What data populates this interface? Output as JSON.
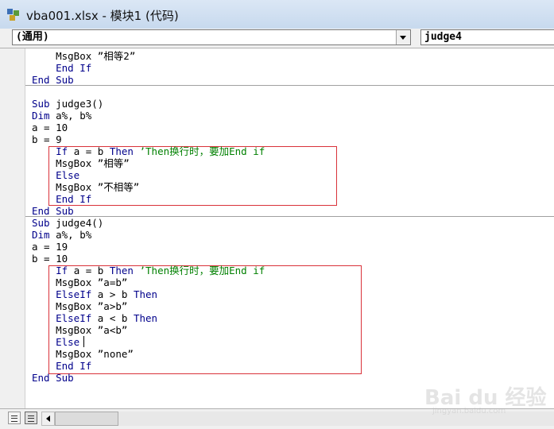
{
  "window": {
    "title": "vba001.xlsx - 模块1 (代码)"
  },
  "combos": {
    "object": "(通用)",
    "procedure": "judge4"
  },
  "code": {
    "lines": [
      [
        {
          "t": "    MsgBox ”相等2”",
          "c": ""
        }
      ],
      [
        {
          "t": "    ",
          "c": ""
        },
        {
          "t": "End If",
          "c": "kw"
        }
      ],
      [
        {
          "t": "End Sub",
          "c": "kw"
        }
      ],
      [
        {
          "t": "",
          "c": ""
        }
      ],
      [
        {
          "t": "Sub",
          "c": "kw"
        },
        {
          "t": " judge3()",
          "c": ""
        }
      ],
      [
        {
          "t": "Dim",
          "c": "kw"
        },
        {
          "t": " a%, b%",
          "c": ""
        }
      ],
      [
        {
          "t": "a = 10",
          "c": ""
        }
      ],
      [
        {
          "t": "b = 9",
          "c": ""
        }
      ],
      [
        {
          "t": "    ",
          "c": ""
        },
        {
          "t": "If",
          "c": "kw"
        },
        {
          "t": " a = b ",
          "c": ""
        },
        {
          "t": "Then",
          "c": "kw"
        },
        {
          "t": " ’Then换行时，要加End if",
          "c": "cm"
        }
      ],
      [
        {
          "t": "    MsgBox ”相等”",
          "c": ""
        }
      ],
      [
        {
          "t": "    ",
          "c": ""
        },
        {
          "t": "Else",
          "c": "kw"
        }
      ],
      [
        {
          "t": "    MsgBox ”不相等”",
          "c": ""
        }
      ],
      [
        {
          "t": "    ",
          "c": ""
        },
        {
          "t": "End If",
          "c": "kw"
        }
      ],
      [
        {
          "t": "End Sub",
          "c": "kw"
        }
      ],
      [
        {
          "t": "Sub",
          "c": "kw"
        },
        {
          "t": " judge4()",
          "c": ""
        }
      ],
      [
        {
          "t": "Dim",
          "c": "kw"
        },
        {
          "t": " a%, b%",
          "c": ""
        }
      ],
      [
        {
          "t": "a = 19",
          "c": ""
        }
      ],
      [
        {
          "t": "b = 10",
          "c": ""
        }
      ],
      [
        {
          "t": "    ",
          "c": ""
        },
        {
          "t": "If",
          "c": "kw"
        },
        {
          "t": " a = b ",
          "c": ""
        },
        {
          "t": "Then",
          "c": "kw"
        },
        {
          "t": " ’Then换行时，要加End if",
          "c": "cm"
        }
      ],
      [
        {
          "t": "    MsgBox ”a=b”",
          "c": ""
        }
      ],
      [
        {
          "t": "    ",
          "c": ""
        },
        {
          "t": "ElseIf",
          "c": "kw"
        },
        {
          "t": " a > b ",
          "c": ""
        },
        {
          "t": "Then",
          "c": "kw"
        }
      ],
      [
        {
          "t": "    MsgBox ”a>b”",
          "c": ""
        }
      ],
      [
        {
          "t": "    ",
          "c": ""
        },
        {
          "t": "ElseIf",
          "c": "kw"
        },
        {
          "t": " a < b ",
          "c": ""
        },
        {
          "t": "Then",
          "c": "kw"
        }
      ],
      [
        {
          "t": "    MsgBox ”a<b”",
          "c": ""
        }
      ],
      [
        {
          "t": "    ",
          "c": ""
        },
        {
          "t": "Else",
          "c": "kw"
        }
      ],
      [
        {
          "t": "    MsgBox ”none”",
          "c": ""
        }
      ],
      [
        {
          "t": "    ",
          "c": ""
        },
        {
          "t": "End If",
          "c": "kw"
        }
      ],
      [
        {
          "t": "End Sub",
          "c": "kw"
        }
      ]
    ]
  },
  "colors": {
    "keyword": "#00008b",
    "comment": "#008000",
    "highlight_box": "#d9323a"
  },
  "watermark": {
    "text": "Bai du 经验",
    "subtext": "jingyan.baidu.com"
  }
}
